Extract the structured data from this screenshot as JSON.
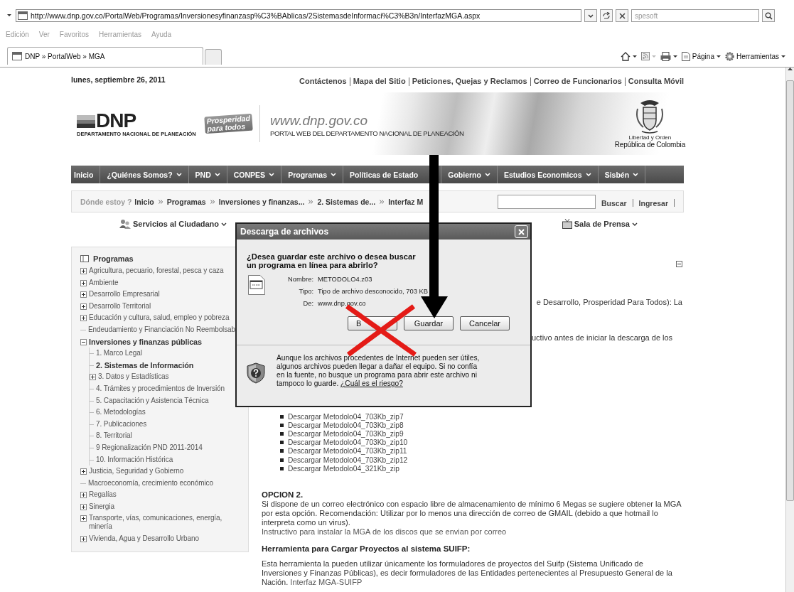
{
  "browser": {
    "address": "http://www.dnp.gov.co/PortalWeb/Programas/Inversionesyfinanzasp%C3%BAblicas/2SistemasdeInformaci%C3%B3n/InterfazMGA.aspx",
    "search_placeholder": "spesoft",
    "menu": [
      "Edición",
      "Ver",
      "Favoritos",
      "Herramientas",
      "Ayuda"
    ],
    "tabs": [
      {
        "label": "DNP » PortalWeb » MGA",
        "selected": true
      }
    ],
    "toolbar": [
      "Página",
      "Herramientas"
    ]
  },
  "date": "lunes, septiembre 26, 2011",
  "top_links": [
    "Contáctenos",
    "Mapa del Sitio",
    "Peticiones, Quejas y Reclamos",
    "Correo de Funcionarios",
    "Consulta Móvil"
  ],
  "header": {
    "logo": "DNP",
    "logo_caption": "DEPARTAMENTO NACIONAL DE PLANEACIÓN",
    "slogan": [
      "Prosperidad",
      "para todos"
    ],
    "site_url": "www.dnp.gov.co",
    "site_title": "PORTAL WEB DEL DEPARTAMENTO NACIONAL DE PLANEACIÓN",
    "motto": "Libertad y Orden",
    "country": "República de Colombia"
  },
  "nav": [
    {
      "label": "Inicio",
      "dropdown": false
    },
    {
      "label": "¿Quiénes Somos?",
      "dropdown": true
    },
    {
      "label": "PND",
      "dropdown": true
    },
    {
      "label": "CONPES",
      "dropdown": true
    },
    {
      "label": "Programas",
      "dropdown": true
    },
    {
      "label": "Políticas de Estado",
      "dropdown": false
    },
    {
      "label": "Gobierno",
      "dropdown": true
    },
    {
      "label": "Estudios Economicos",
      "dropdown": true
    },
    {
      "label": "Sisbén",
      "dropdown": true
    }
  ],
  "breadcrumb": {
    "label": "Dónde estoy ?",
    "items": [
      "Inicio",
      "Programas",
      "Inversiones y finanzas...",
      "2. Sistemas de...",
      "Interfaz M"
    ]
  },
  "search_button": "Buscar",
  "login_link": "Ingresar",
  "secondary_nav": [
    "Servicios al Ciudadano",
    "Sala de Prensa"
  ],
  "sidebar": {
    "title": "Programas",
    "items": [
      {
        "label": "Agricultura, pecuario, forestal, pesca y caza",
        "kind": "folder",
        "expanded": false,
        "selected": false
      },
      {
        "label": "Ambiente",
        "kind": "folder",
        "expanded": false,
        "selected": false
      },
      {
        "label": "Desarrollo Empresarial",
        "kind": "folder",
        "expanded": false,
        "selected": false
      },
      {
        "label": "Desarrollo Territorial",
        "kind": "folder",
        "expanded": false,
        "selected": false
      },
      {
        "label": "Educación y cultura, salud, empleo y pobreza",
        "kind": "folder",
        "expanded": false,
        "selected": false
      },
      {
        "label": "Endeudamiento y Financiación No Reembolsab",
        "kind": "leaf",
        "selected": false
      },
      {
        "label": "Inversiones y finanzas públicas",
        "kind": "folder",
        "expanded": true,
        "selected": false,
        "children": [
          {
            "label": "1. Marco Legal",
            "kind": "leaf",
            "selected": false
          },
          {
            "label": "2. Sistemas de Información",
            "kind": "leaf",
            "selected": true
          },
          {
            "label": "3. Datos y Estadísticas",
            "kind": "folder",
            "expanded": false,
            "selected": false
          },
          {
            "label": "4. Trámites y procedimientos de Inversión",
            "kind": "leaf",
            "selected": false
          },
          {
            "label": "5. Capacitación y Asistencia Técnica",
            "kind": "leaf",
            "selected": false
          },
          {
            "label": "6. Metodologías",
            "kind": "leaf",
            "selected": false
          },
          {
            "label": "7. Publicaciones",
            "kind": "leaf",
            "selected": false
          },
          {
            "label": "8. Territorial",
            "kind": "leaf",
            "selected": false
          },
          {
            "label": "9 Regionalización PND 2011-2014",
            "kind": "leaf",
            "selected": false
          },
          {
            "label": "10. Información Histórica",
            "kind": "leaf",
            "selected": false
          }
        ]
      },
      {
        "label": "Justicia, Seguridad y Gobierno",
        "kind": "folder",
        "expanded": false,
        "selected": false
      },
      {
        "label": "Macroeconomía, crecimiento económico",
        "kind": "leaf",
        "selected": false
      },
      {
        "label": "Regalías",
        "kind": "folder",
        "expanded": false,
        "selected": false
      },
      {
        "label": "Sinergia",
        "kind": "folder",
        "expanded": false,
        "selected": false
      },
      {
        "label": "Transporte, vías, comunicaciones, energía, minería",
        "kind": "folder",
        "expanded": false,
        "selected": false
      },
      {
        "label": "Vivienda, Agua y Desarrollo Urbano",
        "kind": "folder",
        "expanded": false,
        "selected": false
      }
    ]
  },
  "content": {
    "fragments": [
      "e Desarrollo, Prosperidad Para Todos): La",
      "uctivo antes de iniciar la descarga de los"
    ],
    "downloads": [
      "Descargar Metodolo04_703Kb_zip7",
      "Descargar Metodolo04_703Kb_zip8",
      "Descargar Metodolo04_703Kb_zip9",
      "Descargar Metodolo04_703Kb_zip10",
      "Descargar Metodolo04_703Kb_zip11",
      "Descargar Metodolo04_703Kb_zip12",
      "Descargar Metodolo04_321Kb_zip"
    ],
    "option": {
      "heading": "OPCION 2.",
      "text": "Si dispone de un correo electrónico con espacio libre de almacenamiento de mínimo 6 Megas se sugiere obtener la MGA por esta opción. Recomendación: Utilizar por lo menos una dirección de correo de GMAIL (debido a que hotmail lo interpreta como un virus).",
      "link": "Instructivo para instalar la MGA de los discos que se envian por correo"
    },
    "tool": {
      "heading": "Herramienta para Cargar Proyectos al sistema SUIFP:",
      "text": "Esta herramienta la pueden utilizar únicamente los formuladores de proyectos del Suifp (Sistema Unificado de Inversiones y Finanzas Públicas), es decir formuladores de las Entidades pertenecientes al Presupuesto General de la Nación.",
      "link": "Interfaz MGA-SUIFP"
    }
  },
  "dialog": {
    "title": "Descarga de archivos",
    "question": "¿Desea guardar este archivo o desea buscar un programa en línea para abrirlo?",
    "fields": [
      {
        "label": "Nombre:",
        "value": "METODOLO4.z03"
      },
      {
        "label": "Tipo:",
        "value": "Tipo de archivo desconocido, 703 KB"
      },
      {
        "label": "De:",
        "value": "www.dnp.gov.co"
      }
    ],
    "buttons": [
      "B",
      "Guardar",
      "Cancelar"
    ],
    "warning": "Aunque los archivos procedentes de Internet pueden ser útiles, algunos archivos pueden llegar a dañar el equipo. Si no confía en la fuente, no busque un programa para abrir este archivo ni tampoco lo guarde.",
    "risk_link": "¿Cuál es el riesgo?"
  }
}
